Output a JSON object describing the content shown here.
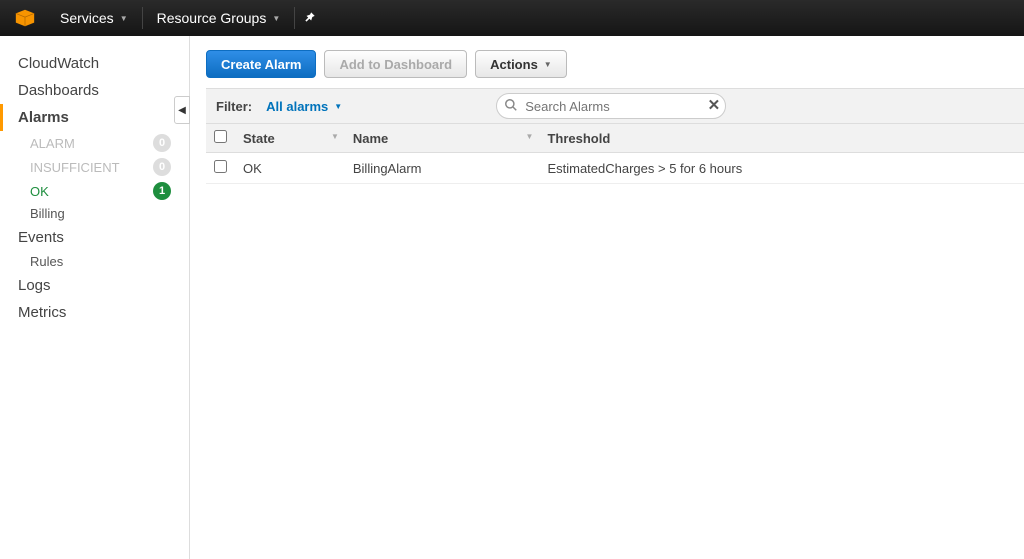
{
  "topnav": {
    "services": "Services",
    "resource_groups": "Resource Groups"
  },
  "sidebar": {
    "cloudwatch": "CloudWatch",
    "dashboards": "Dashboards",
    "alarms_section": "Alarms",
    "alarm_states": {
      "alarm": {
        "label": "ALARM",
        "count": "0"
      },
      "insufficient": {
        "label": "INSUFFICIENT",
        "count": "0"
      },
      "ok": {
        "label": "OK",
        "count": "1"
      }
    },
    "billing": "Billing",
    "events": "Events",
    "rules": "Rules",
    "logs": "Logs",
    "metrics": "Metrics"
  },
  "toolbar": {
    "create_alarm": "Create Alarm",
    "add_to_dashboard": "Add to Dashboard",
    "actions": "Actions"
  },
  "filter": {
    "label": "Filter:",
    "selected": "All alarms",
    "search_placeholder": "Search Alarms"
  },
  "table": {
    "headers": {
      "state": "State",
      "name": "Name",
      "threshold": "Threshold"
    },
    "rows": [
      {
        "state": "OK",
        "name": "BillingAlarm",
        "threshold": "EstimatedCharges > 5 for 6 hours"
      }
    ]
  }
}
